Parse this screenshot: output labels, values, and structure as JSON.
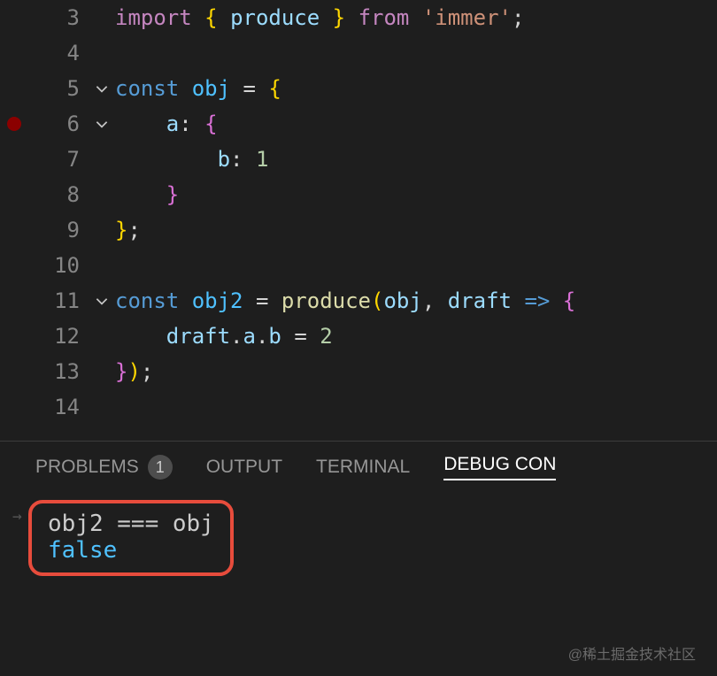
{
  "code": {
    "lines": [
      {
        "num": "3",
        "fold": false,
        "bp": false
      },
      {
        "num": "4",
        "fold": false,
        "bp": false
      },
      {
        "num": "5",
        "fold": true,
        "bp": false
      },
      {
        "num": "6",
        "fold": true,
        "bp": true
      },
      {
        "num": "7",
        "fold": false,
        "bp": false
      },
      {
        "num": "8",
        "fold": false,
        "bp": false
      },
      {
        "num": "9",
        "fold": false,
        "bp": false
      },
      {
        "num": "10",
        "fold": false,
        "bp": false
      },
      {
        "num": "11",
        "fold": true,
        "bp": false
      },
      {
        "num": "12",
        "fold": false,
        "bp": false
      },
      {
        "num": "13",
        "fold": false,
        "bp": false
      },
      {
        "num": "14",
        "fold": false,
        "bp": false
      }
    ],
    "tokens": {
      "import": "import",
      "from": "from",
      "const": "const",
      "produce": "produce",
      "immer": "'immer'",
      "obj": "obj",
      "obj2": "obj2",
      "a": "a",
      "b": "b",
      "draft": "draft",
      "one": "1",
      "two": "2",
      "eq": "=",
      "arrow": "=>",
      "colon": ":",
      "semi": ";",
      "comma": ",",
      "dot": ".",
      "lbrace": "{",
      "rbrace": "}",
      "lparen": "(",
      "rparen": ")"
    }
  },
  "panel": {
    "tabs": {
      "problems": "PROBLEMS",
      "problems_count": "1",
      "output": "OUTPUT",
      "terminal": "TERMINAL",
      "debug": "DEBUG CON"
    }
  },
  "console": {
    "input": "obj2 === obj",
    "output": "false"
  },
  "watermark": "@稀土掘金技术社区"
}
